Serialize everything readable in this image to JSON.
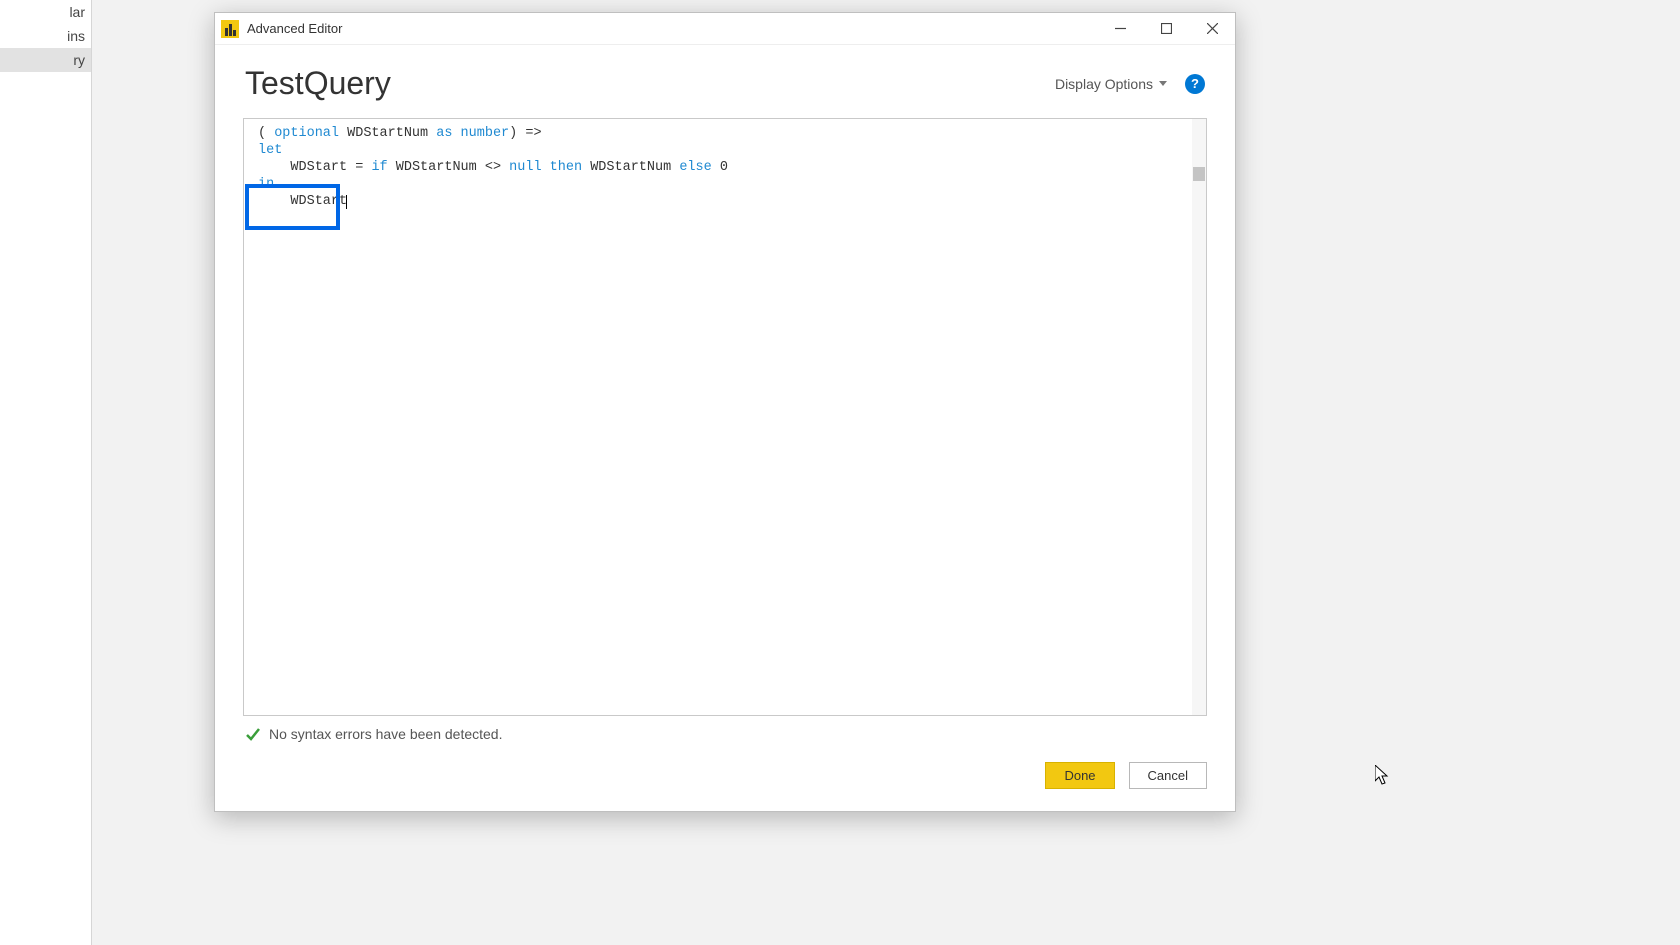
{
  "sidebar": {
    "items": [
      "lar",
      "ins",
      "ry"
    ]
  },
  "dialog": {
    "title": "Advanced Editor",
    "query_name": "TestQuery",
    "display_options_label": "Display Options",
    "help_label": "?",
    "code": {
      "line1_open": "( ",
      "line1_optional": "optional",
      "line1_param": " WDStartNum ",
      "line1_as": "as",
      "line1_type": " number",
      "line1_close": ") =>",
      "line2_let": "let",
      "line3_indent": "    ",
      "line3_var": "WDStart",
      "line3_eq": " = ",
      "line3_if": "if",
      "line3_cond": " WDStartNum <> ",
      "line3_null": "null",
      "line3_then": " then",
      "line3_thenval": " WDStartNum ",
      "line3_else": "else",
      "line3_elseval": " 0",
      "line4_in": "in",
      "line5_indent": "    ",
      "line5_val": "WDStart"
    },
    "status_text": "No syntax errors have been detected.",
    "done_label": "Done",
    "cancel_label": "Cancel"
  }
}
